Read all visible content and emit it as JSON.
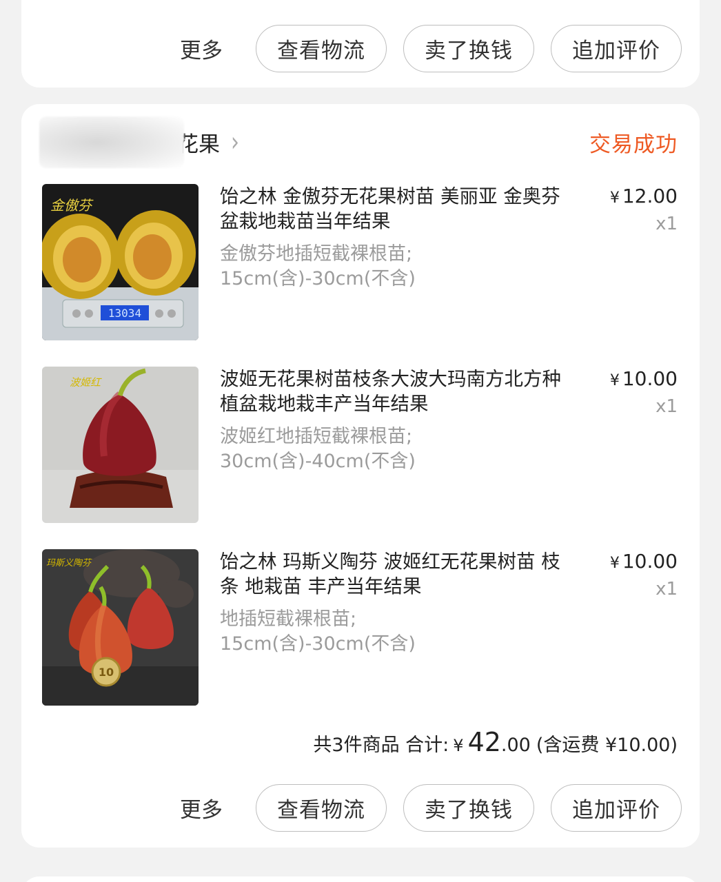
{
  "top_card": {
    "more_label": "更多",
    "buttons": [
      "查看物流",
      "卖了换钱",
      "追加评价"
    ]
  },
  "order": {
    "shop_name_visible": "花果",
    "status": "交易成功",
    "items": [
      {
        "title": "饴之林 金傲芬无花果树苗 美丽亚 金奥芬盆栽地栽苗当年结果",
        "spec_line1": "金傲芬地插短截裸根苗;",
        "spec_line2": "15cm(含)-30cm(不含)",
        "currency": "¥",
        "price": "12.00",
        "qty": "x1",
        "image_caption": "金傲芬",
        "scale_reading": "13034",
        "icon": "fig-cut-on-scale-image"
      },
      {
        "title": "波姬无花果树苗枝条大波大玛南方北方种植盆栽地栽丰产当年结果",
        "spec_line1": "波姬红地插短截裸根苗;",
        "spec_line2": "30cm(含)-40cm(不含)",
        "currency": "¥",
        "price": "10.00",
        "qty": "x1",
        "image_caption": "波姬红",
        "icon": "red-fig-on-stand-image"
      },
      {
        "title": "饴之林 玛斯义陶芬 波姬红无花果树苗  枝条 地栽苗 丰产当年结果",
        "spec_line1": "地插短截裸根苗;",
        "spec_line2": "15cm(含)-30cm(不含)",
        "currency": "¥",
        "price": "10.00",
        "qty": "x1",
        "image_caption": "玛斯义陶芬",
        "coin_text": "10",
        "icon": "three-figs-with-coin-image"
      }
    ],
    "summary": {
      "count_text": "共3件商品 合计:",
      "currency": "¥",
      "total_int": "42",
      "total_dec": ".00",
      "shipping_text": "(含运费 ¥10.00)"
    },
    "more_label": "更多",
    "buttons": [
      "查看物流",
      "卖了换钱",
      "追加评价"
    ]
  },
  "colors": {
    "status": "#ee5a24",
    "background": "#f2f2f2",
    "card": "#ffffff"
  }
}
